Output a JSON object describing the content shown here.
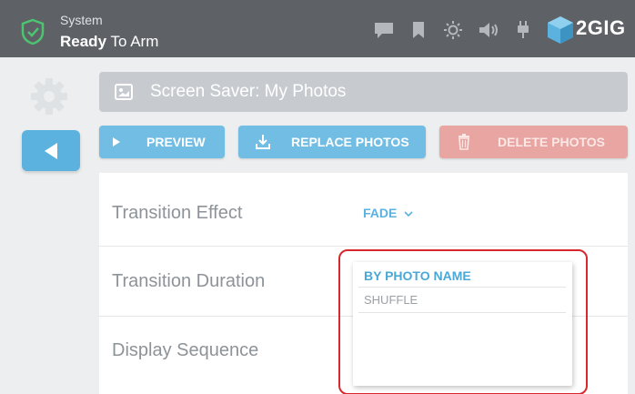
{
  "status": {
    "small_label": "System",
    "bold_label": "Ready",
    "rest_label": "To Arm"
  },
  "header_icons": [
    "message-icon",
    "bookmark-icon",
    "brightness-icon",
    "volume-icon",
    "power-plug-icon"
  ],
  "brand": {
    "name": "2GIG"
  },
  "page": {
    "title": "Screen Saver: My Photos"
  },
  "actions": {
    "preview": "PREVIEW",
    "replace": "REPLACE PHOTOS",
    "delete": "DELETE PHOTOS"
  },
  "settings": {
    "transition_effect": {
      "label": "Transition Effect",
      "value": "FADE"
    },
    "transition_duration": {
      "label": "Transition Duration"
    },
    "display_sequence": {
      "label": "Display Sequence"
    }
  },
  "dropdown": {
    "options": [
      "BY PHOTO NAME",
      "SHUFFLE"
    ],
    "selected": "BY PHOTO NAME"
  },
  "colors": {
    "topbar": "#5e6166",
    "accent": "#5bb2de",
    "danger": "#e8a5a1",
    "shield": "#4cc470",
    "highlight": "#d8282e"
  }
}
